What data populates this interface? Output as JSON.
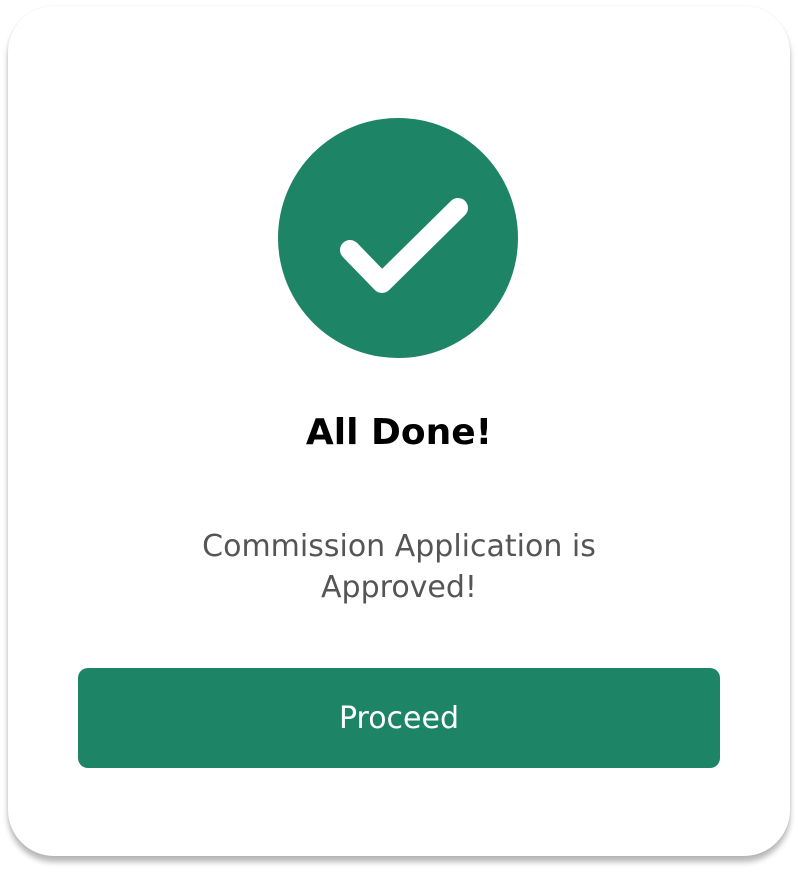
{
  "dialog": {
    "icon": "check-icon",
    "title": "All Done!",
    "message": "Commission Application is Approved!",
    "button_label": "Proceed"
  },
  "colors": {
    "accent": "#1e8466",
    "title": "#000000",
    "message": "#555555",
    "button_text": "#ffffff"
  }
}
